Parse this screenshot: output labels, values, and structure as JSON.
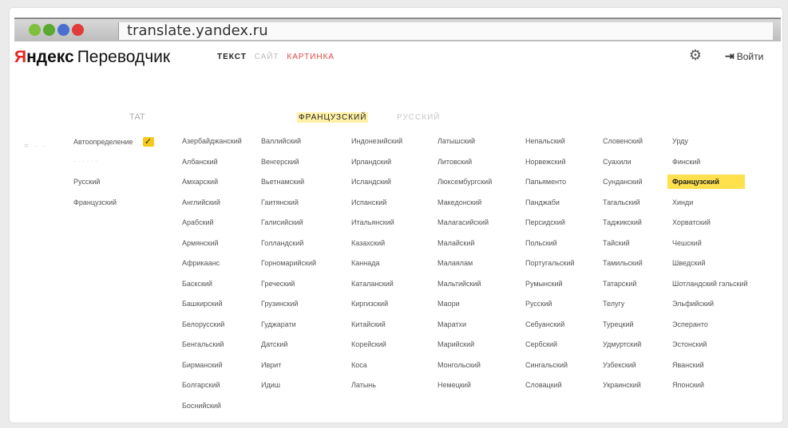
{
  "browser": {
    "url": "translate.yandex.ru"
  },
  "header": {
    "logo_ya": "Я",
    "logo_brand": "ндекс",
    "logo_product": "Переводчик",
    "modes": [
      "ТЕКСТ",
      "САЙТ",
      "КАРТИНКА"
    ],
    "settings_icon": "gear-icon",
    "login_label": "Войти",
    "colors": {
      "accent": "#ffe14d",
      "logo_red": "#e52620"
    }
  },
  "langbar": {
    "source": "ТАТ",
    "target": "ФРАНЦУЗСКИЙ",
    "alternative": "РУССКИЙ"
  },
  "panel": {
    "auto_detect": "Автоопределение",
    "recent": [
      "Русский",
      "Французский"
    ],
    "selected_language": "Французский",
    "columns": [
      [
        "Азербайджанский",
        "Албанский",
        "Амхарский",
        "Английский",
        "Арабский",
        "Армянский",
        "Африкаанс",
        "Баскский",
        "Башкирский",
        "Белорусский",
        "Бенгальский",
        "Бирманский",
        "Болгарский",
        "Боснийский"
      ],
      [
        "Валлийский",
        "Венгерский",
        "Вьетнамский",
        "Гаитянский",
        "Галисийский",
        "Голландский",
        "Горномарийский",
        "Греческий",
        "Грузинский",
        "Гуджарати",
        "Датский",
        "Иврит",
        "Идиш"
      ],
      [
        "Индонезийский",
        "Ирландский",
        "Исландский",
        "Испанский",
        "Итальянский",
        "Казахский",
        "Каннада",
        "Каталанский",
        "Киргизский",
        "Китайский",
        "Корейский",
        "Коса",
        "Латынь"
      ],
      [
        "Латышский",
        "Литовский",
        "Люксембургский",
        "Македонский",
        "Малагасийский",
        "Малайский",
        "Малаялам",
        "Мальтийский",
        "Маори",
        "Маратхи",
        "Марийский",
        "Монгольский",
        "Немецкий"
      ],
      [
        "Непальский",
        "Норвежский",
        "Папьяменто",
        "Панджаби",
        "Персидский",
        "Польский",
        "Португальский",
        "Румынский",
        "Русский",
        "Себуанский",
        "Сербский",
        "Сингальский",
        "Словацкий"
      ],
      [
        "Словенский",
        "Суахили",
        "Сунданский",
        "Тагальский",
        "Таджикский",
        "Тайский",
        "Тамильский",
        "Татарский",
        "Телугу",
        "Турецкий",
        "Удмуртский",
        "Узбекский",
        "Украинский"
      ],
      [
        "Урду",
        "Финский",
        "Французский",
        "Хинди",
        "Хорватский",
        "Чешский",
        "Шведский",
        "Шотландский гэльский",
        "Эльфийский",
        "Эсперанто",
        "Эстонский",
        "Яванский",
        "Японский"
      ]
    ]
  }
}
